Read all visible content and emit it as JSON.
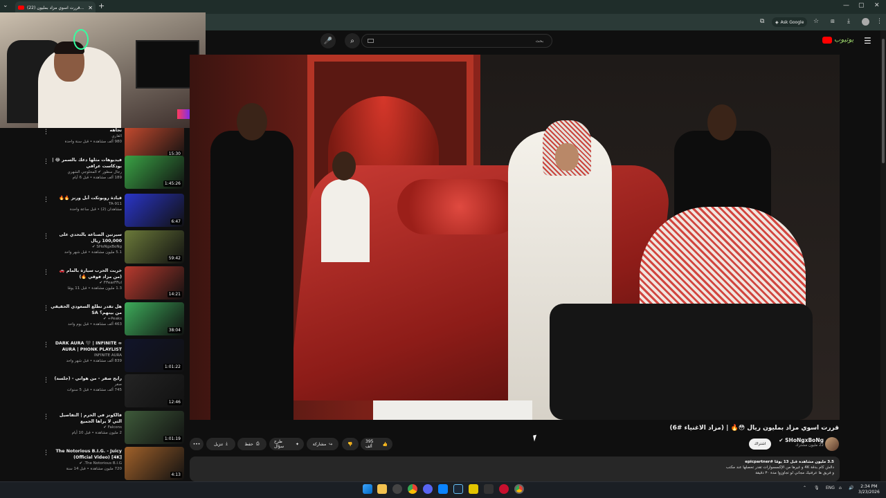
{
  "browser": {
    "tab_title": "(22) قررت اسوي مزاد بمليون...",
    "new_tab": "+",
    "ask_google": "Ask Google",
    "window_controls": [
      "—",
      "▢",
      "✕"
    ]
  },
  "youtube": {
    "search_placeholder": "بحث",
    "logo_text": "يوتيوب"
  },
  "sidebar": {
    "items": [
      {
        "title": "تجاهه",
        "channel": "القاري",
        "views": "980 ألف مشاهدة • قبل سنة واحدة",
        "duration": "15:30",
        "thumb": "#c64b2f",
        "progress": 0.4
      },
      {
        "title": "فيديوهات مثلها دعك بالسمر 😂 | بودكاست عرافي",
        "channel": "رجال سطور ✔ المحلوجي الشهري",
        "views": "189 ألف مشاهدة • قبل 6 أيام",
        "duration": "1:45:26",
        "thumb": "#3aa245",
        "progress": 0
      },
      {
        "title": "قيادة روبوتكت أبل ورنز 🔥🔥",
        "channel": "TA-911",
        "views": "مشاهدان (2) • قبل ساعة واحدة",
        "duration": "6:47",
        "thumb": "#2a35c8",
        "progress": 0
      },
      {
        "title": "سيرتين الصناعة بالتحدي على 100,000 ريال",
        "channel": "SHoNgxBoNg ✔",
        "views": "5.1 مليون مشاهدة • قبل شهر واحد",
        "duration": "59:42",
        "thumb": "#6b7a3a",
        "progress": 0
      },
      {
        "title": "خربت الحرب سيارة بالمام 🚗 (من مزاد فوقي 🔥)",
        "channel": "FFearFFul ✔",
        "views": "1.3 مليون مشاهدة • قبل 11 يومًا",
        "duration": "14:21",
        "thumb": "#b83a2e",
        "progress": 0
      },
      {
        "title": "هل تقدر تطلع السعودي الحقيقي من بينهم؟ SA",
        "channel": "Peaks+ ✔",
        "views": "463 ألف مشاهدة • قبل يوم واحد",
        "duration": "38:04",
        "thumb": "#3dab5a",
        "progress": 0
      },
      {
        "title": "DARK AURA 🖤 | INFINITE ∞ AURA | PHONK PLAYLIST FOR...",
        "channel": "INFINITE AURA",
        "views": "839 ألف مشاهدة • قبل شهر واحد",
        "duration": "1:01:22",
        "thumb": "#11142a",
        "progress": 0
      },
      {
        "title": "رابح صقر - من هواني - (جلسة)",
        "channel": "صقر",
        "views": "745 ألف مشاهدة • قبل 5 سنوات",
        "duration": "12:46",
        "thumb": "#242424",
        "progress": 0
      },
      {
        "title": "فالكونز في الحرم | التفاصيل التي لا يراها الجميع",
        "channel": "Falcons ✔",
        "views": "2 مليون مشاهدة • قبل 10 أيام",
        "duration": "1:01:19",
        "thumb": "#3e5a3a",
        "progress": 0
      },
      {
        "title": "The Notorious B.I.G. - Juicy (Official Video) [4K]",
        "channel": "The Notorious B.I.G. ✔",
        "views": "720 مليون مشاهدة • قبل 14 سنة",
        "duration": "4:13",
        "thumb": "#a0612a",
        "progress": 0
      }
    ]
  },
  "video": {
    "title": "قررت اسوي مزاد بمليون ريال 😳🔥 | (مزاد الاغنياء #6)",
    "channel_name": "SHoNgxBoNg ✔",
    "subscribers": "22 مليون مشترك",
    "subscribe_label": "اشتراك",
    "likes": "395 ألف",
    "share_label": "مشاركة",
    "clip_label": "طرح سؤال",
    "save_label": "حفظ",
    "download_label": "تنزيل",
    "more_label": "•••",
    "description": {
      "stats": "3.5 مليون مشاهدة  قبل 13 يومًا  #epicpartner",
      "line1": "دالش كام بدقة 4K و غيرها من الإكسسوارات تقدر تحصلها عند مكتب",
      "line2": "و فريق ها عرفنيك مجاني لو تجاوزوا مدة ٣٠ دقيقة"
    }
  },
  "taskbar": {
    "lang": "ENG",
    "time": "2:34 PM",
    "date": "3/23/2026"
  }
}
